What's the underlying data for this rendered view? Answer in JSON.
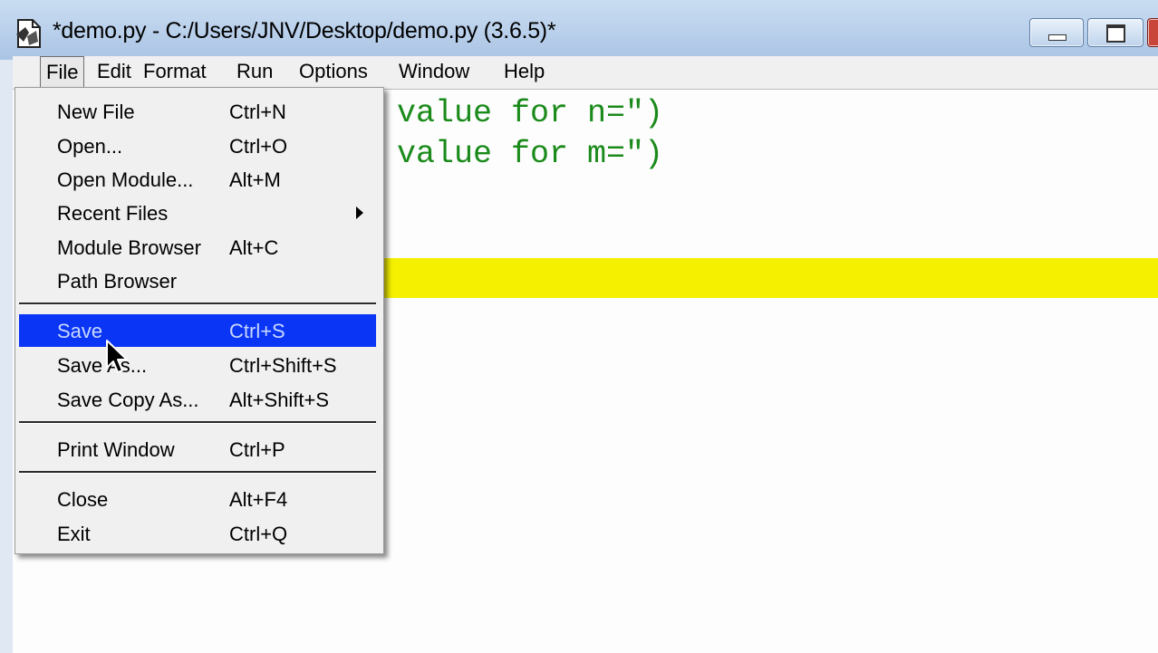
{
  "window": {
    "title": "*demo.py - C:/Users/JNV/Desktop/demo.py (3.6.5)*"
  },
  "menubar": {
    "items": [
      {
        "label": "File"
      },
      {
        "label": "Edit"
      },
      {
        "label": "Format"
      },
      {
        "label": "Run"
      },
      {
        "label": "Options"
      },
      {
        "label": "Window"
      },
      {
        "label": "Help"
      }
    ]
  },
  "editor": {
    "lines": [
      "value for n=\")",
      "value for m=\")"
    ],
    "highlight_color": "#f4f000",
    "code_color": "#1a8a1a"
  },
  "file_menu": {
    "items": [
      {
        "label": "New File",
        "shortcut": "Ctrl+N"
      },
      {
        "label": "Open...",
        "shortcut": "Ctrl+O"
      },
      {
        "label": "Open Module...",
        "shortcut": "Alt+M"
      },
      {
        "label": "Recent Files",
        "shortcut": ""
      },
      {
        "label": "Module Browser",
        "shortcut": "Alt+C"
      },
      {
        "label": "Path Browser",
        "shortcut": ""
      },
      {
        "label": "Save",
        "shortcut": "Ctrl+S"
      },
      {
        "label": "Save As...",
        "shortcut": "Ctrl+Shift+S"
      },
      {
        "label": "Save Copy As...",
        "shortcut": "Alt+Shift+S"
      },
      {
        "label": "Print Window",
        "shortcut": "Ctrl+P"
      },
      {
        "label": "Close",
        "shortcut": "Alt+F4"
      },
      {
        "label": "Exit",
        "shortcut": "Ctrl+Q"
      }
    ],
    "selected": "Save",
    "selection_color": "#0a35f5"
  },
  "icons": {
    "app": "idle-app-icon",
    "submenu": "submenu-arrow-icon",
    "cursor": "mouse-cursor-icon"
  }
}
